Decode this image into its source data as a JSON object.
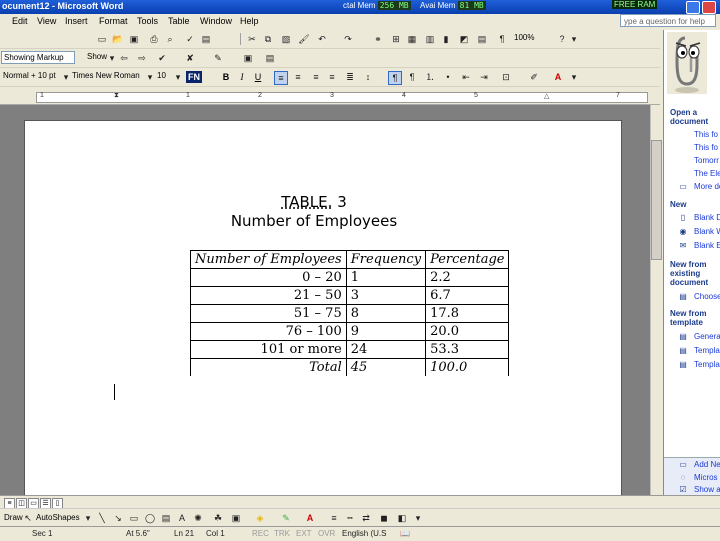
{
  "window": {
    "title": "ocument12 - Microsoft Word"
  },
  "memory": {
    "total_label": "ctal Mem",
    "total_value": "256 MB",
    "avail_label": "Avai Mem",
    "avail_value": "81 MB",
    "free_ram": "FREE RAM"
  },
  "menu": {
    "items": [
      "Edit",
      "View",
      "Insert",
      "Format",
      "Tools",
      "Table",
      "Window",
      "Help"
    ],
    "help_placeholder": "ype a question for help"
  },
  "toolbar_review": {
    "showing_markup": "Showing Markup",
    "show": "Show",
    "zoom": "100%"
  },
  "toolbar_format": {
    "style": "Normal + 10 pt",
    "font": "Times New Roman",
    "size": "10",
    "fn": "FN",
    "bold": "B",
    "italic": "I",
    "underline": "U"
  },
  "document": {
    "caption_label": "TABLE.",
    "caption_number": "3",
    "caption_title": "Number of Employees",
    "table": {
      "headers": [
        "Number of Employees",
        "Frequency",
        "Percentage"
      ],
      "rows": [
        {
          "range": "0 – 20",
          "frequency": "1",
          "percentage": "2.2"
        },
        {
          "range": "21 – 50",
          "frequency": "3",
          "percentage": "6.7"
        },
        {
          "range": "51 – 75",
          "frequency": "8",
          "percentage": "17.8"
        },
        {
          "range": "76 – 100",
          "frequency": "9",
          "percentage": "20.0"
        },
        {
          "range": "101 or more",
          "frequency": "24",
          "percentage": "53.3"
        },
        {
          "range": "Total",
          "frequency": "45",
          "percentage": "100.0"
        }
      ]
    }
  },
  "taskpane": {
    "open_heading": "Open a document",
    "open_files": [
      "This fo",
      "This fo",
      "Tomorr",
      "The Ele"
    ],
    "more_docs": "More do",
    "new_heading": "New",
    "new_items": [
      "Blank D",
      "Blank W",
      "Blank E"
    ],
    "existing_heading": "New from existing document",
    "choose": "Choose",
    "template_heading": "New from template",
    "template_items": [
      "Genera",
      "Templa",
      "Templa"
    ],
    "bottom_items": [
      "Add Ne",
      "Micros",
      "Show a"
    ]
  },
  "drawbar": {
    "draw": "Draw",
    "autoshapes": "AutoShapes"
  },
  "statusbar": {
    "sec": "Sec 1",
    "at": "At 5.6\"",
    "ln": "Ln 21",
    "col": "Col 1",
    "rec": "REC",
    "trk": "TRK",
    "ext": "EXT",
    "ovr": "OVR",
    "lang": "English (U.S"
  }
}
